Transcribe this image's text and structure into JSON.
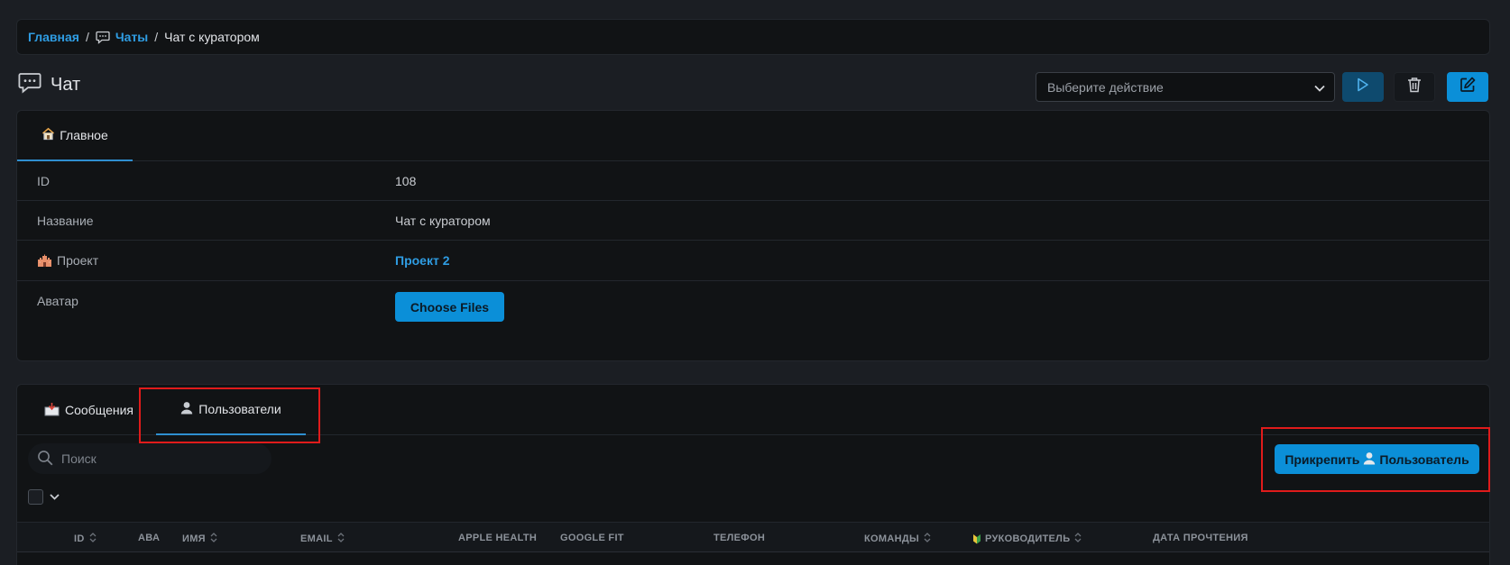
{
  "breadcrumb": {
    "home": "Главная",
    "chats": "Чаты",
    "current": "Чат с куратором",
    "separator": "/"
  },
  "header": {
    "title": "Чат",
    "action_placeholder": "Выберите действие"
  },
  "main_panel": {
    "tab_label": "Главное",
    "fields": {
      "id_label": "ID",
      "id_value": "108",
      "name_label": "Название",
      "name_value": "Чат с куратором",
      "project_label": "Проект",
      "project_value": "Проект 2",
      "avatar_label": "Аватар",
      "avatar_button": "Choose Files"
    }
  },
  "users_panel": {
    "tabs": {
      "messages": "Сообщения",
      "users": "Пользователи"
    },
    "search_placeholder": "Поиск",
    "attach_prefix": "Прикрепить",
    "attach_suffix": "Пользователь",
    "columns": {
      "id": "ID",
      "ava": "АВА",
      "name": "ИМЯ",
      "email": "EMAIL",
      "apple_health": "APPLE HEALTH",
      "google_fit": "GOOGLE FIT",
      "phone": "ТЕЛЕФОН",
      "teams": "КОМАНДЫ",
      "manager": "РУКОВОДИТЕЛЬ",
      "read_date": "ДАТА ПРОЧТЕНИЯ"
    }
  },
  "colors": {
    "accent": "#0b8fd8",
    "link": "#2f9de3",
    "highlight": "#e01b1b",
    "background": "#1b1e23",
    "panel": "#111315"
  }
}
